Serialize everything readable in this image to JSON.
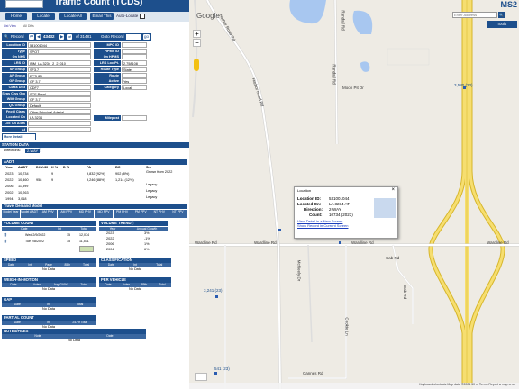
{
  "app": {
    "title": "Traffic Count (TCDS)",
    "logo_text": "MS2"
  },
  "toolbar": {
    "home": "Home",
    "locate": "Locate",
    "locate_all": "Locate All",
    "email_this": "Email This",
    "auto_locate": "Auto-Locate"
  },
  "tabs": {
    "list_view": "List View",
    "all_diffs": "All Diffs"
  },
  "record": {
    "label": "Record",
    "id": "43432",
    "of": "of 31481",
    "goto": "Goto Record",
    "go": "go"
  },
  "fields_left": [
    {
      "label": "Location ID",
      "value": "531001044"
    },
    {
      "label": "Type",
      "value": "SPOT"
    },
    {
      "label": "On NHS",
      "value": ""
    },
    {
      "label": "LRS ID",
      "value": "INM_LA 3234_2_2_010"
    },
    {
      "label": "SF Group",
      "value": "SF3.7"
    },
    {
      "label": "AF Group",
      "value": "FC7URI"
    },
    {
      "label": "GF Group",
      "value": "GF 3.7"
    },
    {
      "label": "Class Dist Grp",
      "value": "CDF7"
    },
    {
      "label": "Seas Clss Grp",
      "value": "SCF Rural"
    },
    {
      "label": "WIM Group",
      "value": "GF 3.7"
    },
    {
      "label": "QC Group",
      "value": "Default"
    },
    {
      "label": "Fnct'l Class",
      "value": "Other Principal Arterial"
    },
    {
      "label": "Located On",
      "value": "LA 3234"
    },
    {
      "label": "Loc On Alias",
      "value": ""
    },
    {
      "label": "At",
      "value": ""
    }
  ],
  "fields_right": [
    {
      "label": "MPO ID",
      "value": ""
    },
    {
      "label": "HPMS ID",
      "value": ""
    },
    {
      "label": "On HPMS",
      "value": ""
    },
    {
      "label": "LRS Loc Pt.",
      "value": "2.758108"
    },
    {
      "label": "Route Type",
      "value": "State"
    },
    {
      "label": "Route",
      "value": ""
    },
    {
      "label": "Active",
      "value": "Yes"
    },
    {
      "label": "Category",
      "value": "Local"
    },
    {
      "label": "Milepost",
      "value": ""
    }
  ],
  "more_detail": "More Detail",
  "station_data": {
    "title": "STATION DATA",
    "directions_label": "Directions:",
    "directions_value": "2-WAY"
  },
  "aadt": {
    "title": "AADT",
    "headers": [
      "Year",
      "AADT",
      "DHV-30",
      "K %",
      "D %",
      "PA",
      "BC",
      "Src"
    ],
    "rows": [
      {
        "year": "2023",
        "aadt": "10,734",
        "dhv": "",
        "k": "9",
        "d": "",
        "pa": "9,832 (92%)",
        "bc": "902 (8%)",
        "src": "Grown from 2022"
      },
      {
        "year": "2022",
        "aadt": "10,460",
        "dhv": "958",
        "k": "9",
        "d": "",
        "pa": "9,246 (88%)",
        "bc": "1,214 (12%)",
        "src": ""
      },
      {
        "year": "2006",
        "aadt": "11,899",
        "dhv": "",
        "k": "",
        "d": "",
        "pa": "",
        "bc": "",
        "src": "Legacy"
      },
      {
        "year": "2002",
        "aadt": "10,263",
        "dhv": "",
        "k": "",
        "d": "",
        "pa": "",
        "bc": "",
        "src": "Legacy"
      },
      {
        "year": "1994",
        "aadt": "3,018",
        "dhv": "",
        "k": "",
        "d": "",
        "pa": "",
        "bc": "",
        "src": "Legacy"
      }
    ]
  },
  "travel_demand": {
    "title": "Travel Demand Model",
    "headers": [
      "Model Year",
      "Model AADT",
      "AM PHV",
      "AM PPV",
      "MD PHV",
      "MD PPV",
      "PM PHV",
      "PM PPV",
      "NT PHV",
      "NT PPV"
    ]
  },
  "volume_count": {
    "title": "VOLUME COUNT",
    "headers": [
      "Date",
      "Int",
      "Total"
    ],
    "rows": [
      {
        "date": "Wed 2/9/2022",
        "int": "15",
        "total": "12,074"
      },
      {
        "date": "Tue 2/8/2022",
        "int": "15",
        "total": "11,571"
      }
    ]
  },
  "volume_trend": {
    "title": "VOLUME TREND",
    "headers": [
      "Year",
      "Annual Growth"
    ],
    "rows": [
      {
        "year": "2023",
        "growth": "3%"
      },
      {
        "year": "2022",
        "growth": "-1%"
      },
      {
        "year": "2006",
        "growth": "1%"
      },
      {
        "year": "2004",
        "growth": "6%"
      }
    ]
  },
  "speed": {
    "title": "SPEED",
    "headers": [
      "Date",
      "Int",
      "Pace",
      "85th",
      "Total"
    ],
    "empty": "No Data"
  },
  "classification": {
    "title": "CLASSIFICATION",
    "headers": [
      "Date",
      "Int",
      "Total"
    ],
    "empty": "No Data"
  },
  "weigh": {
    "title": "WEIGH-IN-MOTION",
    "headers": [
      "Date",
      "Axles",
      "Avg GVW",
      "Total"
    ],
    "empty": "No Data"
  },
  "per_vehicle": {
    "title": "PER VEHICLE",
    "headers": [
      "Date",
      "Axles",
      "85th",
      "Total"
    ],
    "empty": "No Data"
  },
  "gap": {
    "title": "GAP",
    "headers": [
      "Date",
      "Int",
      "Total"
    ],
    "empty": "No Data"
  },
  "partial": {
    "title": "PARTIAL COUNT",
    "headers": [
      "Date",
      "Int",
      "24-Hr Total"
    ],
    "empty": "No Data"
  },
  "notes": {
    "title": "NOTES/FILES",
    "headers": [
      "Note",
      "Date"
    ],
    "empty": "No Data"
  },
  "map": {
    "search_placeholder": "Enter Address",
    "tools": "Tools",
    "brand": "MS2",
    "google": "Google",
    "zoom_in": "+",
    "zoom_out": "−",
    "footer": "Keyboard shortcuts   Map data ©2024   50 m   Terms   Report a map error",
    "road_labels": {
      "wardline_l": "Wardline Rd",
      "wardline_m": "Wardline Rd",
      "wardline_r": "Wardline Rd",
      "wardline_r2": "Wardline Rd",
      "randall": "Randall Rd",
      "randall2": "Randall Rd",
      "moon": "Moon Pit Dr",
      "cab": "Cab Rd",
      "cannes": "Cannes Rd",
      "cab2": "Cab Rd",
      "cookie": "Cookie Ln",
      "mcneely": "McNeely Dr",
      "harbor1": "Harbor Road Rd",
      "harbor2": "Harbor Road Rd",
      "count1": "3,580 (23)",
      "count2": "3,241 (23)",
      "count3": "541 (23)"
    },
    "popup": {
      "title": "Location",
      "loc_id_label": "Location ID:",
      "loc_id": "531001044",
      "located_on_label": "Located On:",
      "located_on": "LA 3234 AT",
      "direction_label": "Direction:",
      "direction": "2-WAY",
      "count_label": "Count:",
      "count": "10734 (2023)",
      "link1": "View Detail in a New Screen",
      "link2": "Show Record in Current Screen",
      "close": "×"
    }
  }
}
